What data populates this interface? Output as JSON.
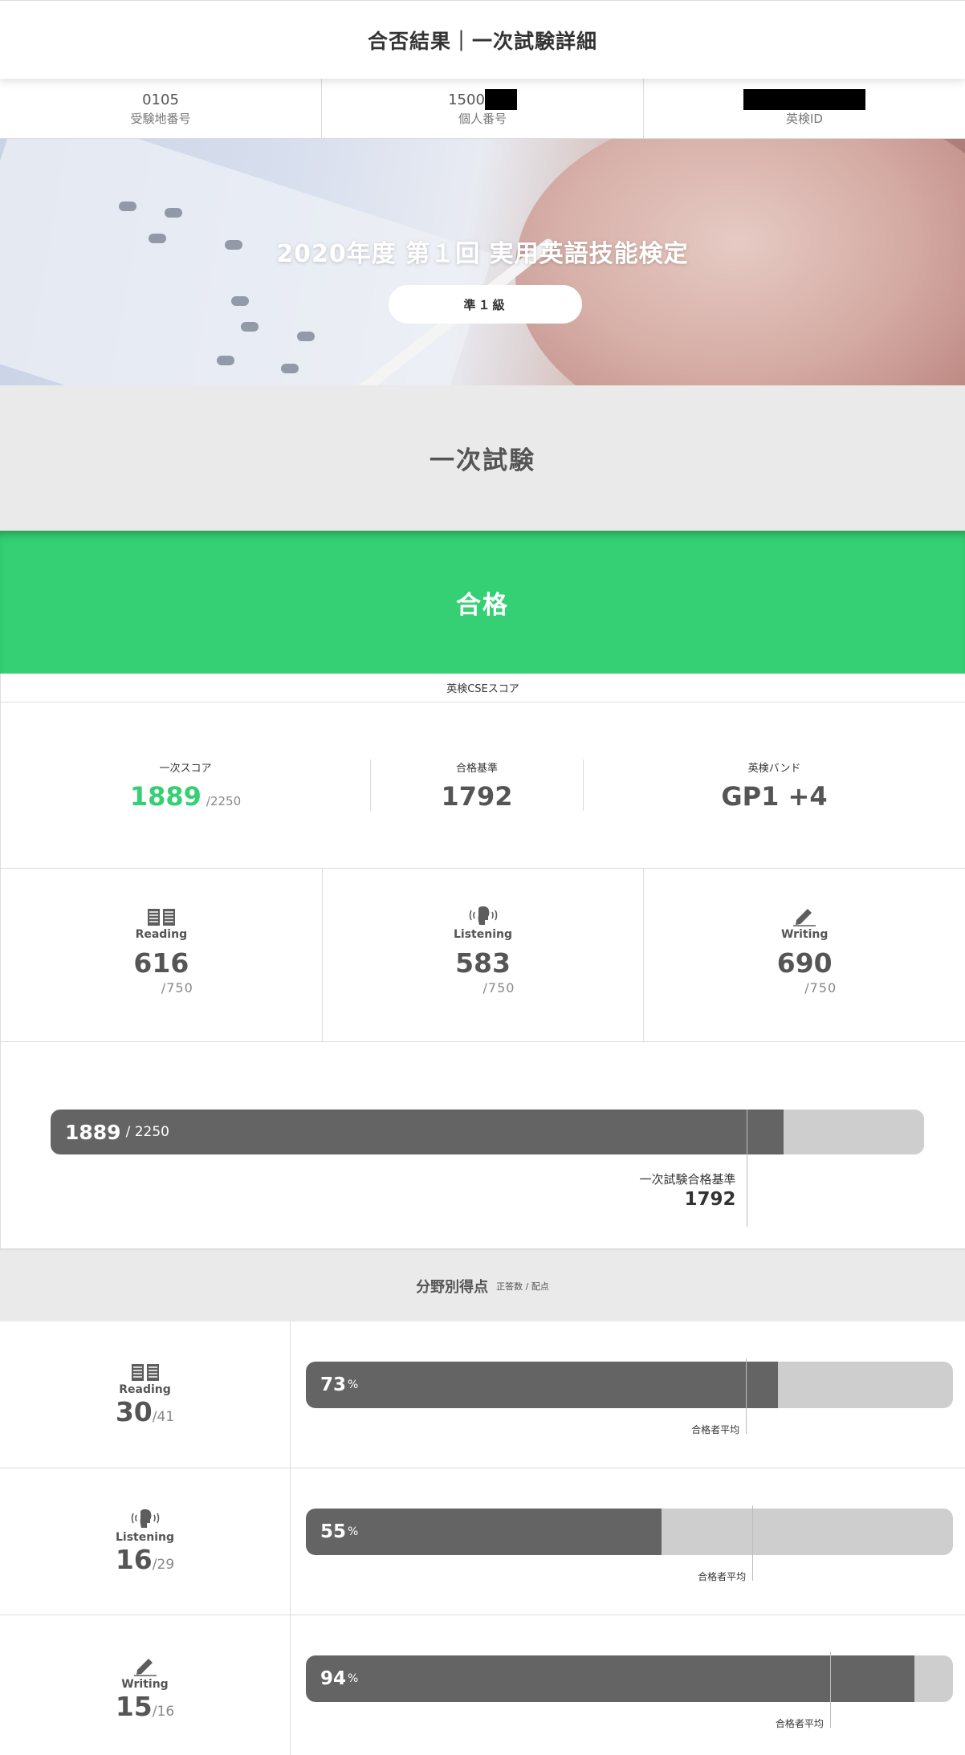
{
  "header": {
    "title": "合否結果｜一次試験詳細"
  },
  "ids": [
    {
      "value": "0105",
      "label": "受験地番号"
    },
    {
      "value": "1500",
      "label": "個人番号"
    },
    {
      "value": "",
      "label": "英検ID"
    }
  ],
  "hero": {
    "title": "2020年度 第１回 実用英語技能検定",
    "grade": "準１級"
  },
  "section": {
    "title": "一次試験"
  },
  "result": {
    "label": "合格"
  },
  "cse": {
    "label": "英検CSEスコア",
    "first_score": {
      "label": "一次スコア",
      "value": "1889",
      "max": "/2250"
    },
    "pass_standard": {
      "label": "合格基準",
      "value": "1792"
    },
    "band": {
      "label": "英検バンド",
      "value": "GP1 +4"
    }
  },
  "skills": [
    {
      "name": "Reading",
      "value": "616",
      "max": "/750",
      "icon": "book-icon"
    },
    {
      "name": "Listening",
      "value": "583",
      "max": "/750",
      "icon": "listening-head-icon"
    },
    {
      "name": "Writing",
      "value": "690",
      "max": "/750",
      "icon": "pencil-icon"
    }
  ],
  "total_bar": {
    "score": "1889",
    "max_text": "/ 2250",
    "score_num": 1889,
    "max_num": 2250,
    "pass_label": "一次試験合格基準",
    "pass_value": "1792",
    "pass_num": 1792
  },
  "fields": {
    "title": "分野別得点",
    "subtitle": "正答数 / 配点",
    "rows": [
      {
        "name": "Reading",
        "correct": "30",
        "total": "/41",
        "percent_text": "73",
        "percent": 73,
        "avg_label": "合格者平均",
        "avg_percent": 68,
        "icon": "book-icon"
      },
      {
        "name": "Listening",
        "correct": "16",
        "total": "/29",
        "percent_text": "55",
        "percent": 55,
        "avg_label": "合格者平均",
        "avg_percent": 69,
        "icon": "listening-head-icon"
      },
      {
        "name": "Writing",
        "correct": "15",
        "total": "/16",
        "percent_text": "94",
        "percent": 94,
        "avg_label": "合格者平均",
        "avg_percent": 81,
        "icon": "pencil-icon"
      }
    ],
    "unit": "%"
  }
}
